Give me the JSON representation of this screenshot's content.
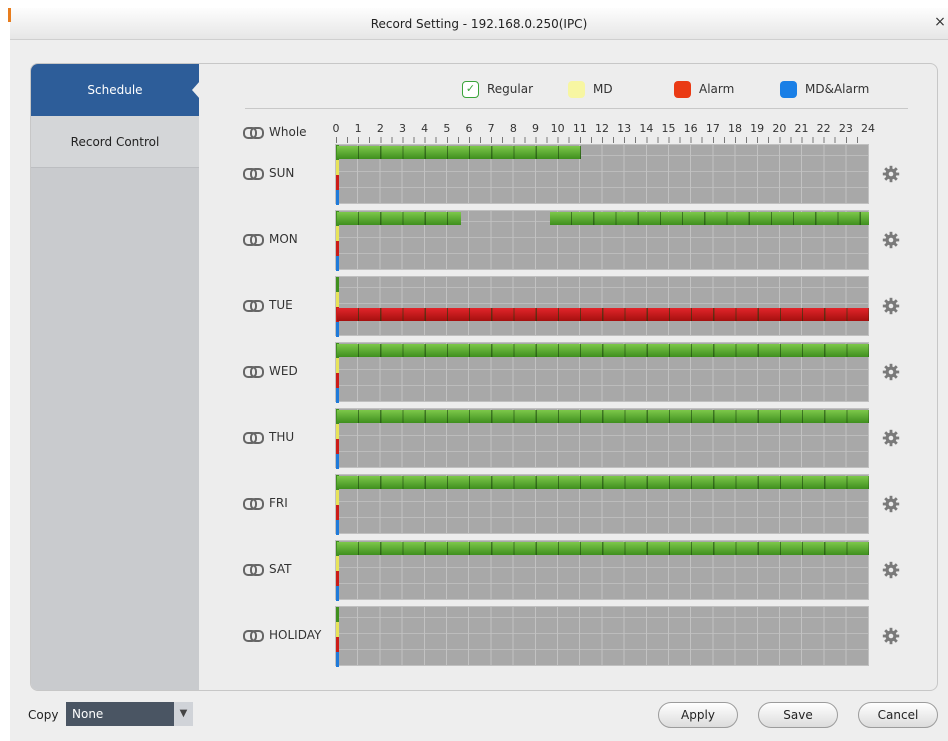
{
  "window": {
    "title": "Record Setting - 192.168.0.250(IPC)",
    "close_glyph": "×"
  },
  "sidebar": {
    "items": [
      {
        "label": "Schedule",
        "active": true
      },
      {
        "label": "Record Control",
        "active": false
      }
    ]
  },
  "legend": [
    {
      "label": "Regular",
      "color": "#3aa43a",
      "icon": "check-icon"
    },
    {
      "label": "MD",
      "color": "#f7f6a2"
    },
    {
      "label": "Alarm",
      "color": "#ea3a14"
    },
    {
      "label": "MD&Alarm",
      "color": "#1a7fe6"
    }
  ],
  "whole_label": "Whole",
  "hours": [
    "0",
    "1",
    "2",
    "3",
    "4",
    "5",
    "6",
    "7",
    "8",
    "9",
    "10",
    "11",
    "12",
    "13",
    "14",
    "15",
    "16",
    "17",
    "18",
    "19",
    "20",
    "21",
    "22",
    "23",
    "24"
  ],
  "days": [
    {
      "label": "SUN",
      "regular": [
        [
          0,
          11
        ]
      ],
      "alarm": []
    },
    {
      "label": "MON",
      "regular": [
        [
          0,
          5.6
        ],
        [
          9.6,
          24
        ]
      ],
      "alarm": []
    },
    {
      "label": "TUE",
      "regular": [],
      "alarm": [
        [
          0,
          24
        ]
      ]
    },
    {
      "label": "WED",
      "regular": [
        [
          0,
          24
        ]
      ],
      "alarm": []
    },
    {
      "label": "THU",
      "regular": [
        [
          0,
          24
        ]
      ],
      "alarm": []
    },
    {
      "label": "FRI",
      "regular": [
        [
          0,
          24
        ]
      ],
      "alarm": []
    },
    {
      "label": "SAT",
      "regular": [
        [
          0,
          24
        ]
      ],
      "alarm": []
    },
    {
      "label": "HOLIDAY",
      "regular": [],
      "alarm": []
    }
  ],
  "row_icons": {
    "link": "link-icon",
    "settings": "gear-icon"
  },
  "footer": {
    "copy_label": "Copy",
    "copy_value": "None",
    "buttons": {
      "apply": "Apply",
      "save": "Save",
      "cancel": "Cancel"
    }
  },
  "colors": {
    "accent": "#2d5d99",
    "regular": "#4a9a28",
    "alarm": "#d21a1f"
  }
}
